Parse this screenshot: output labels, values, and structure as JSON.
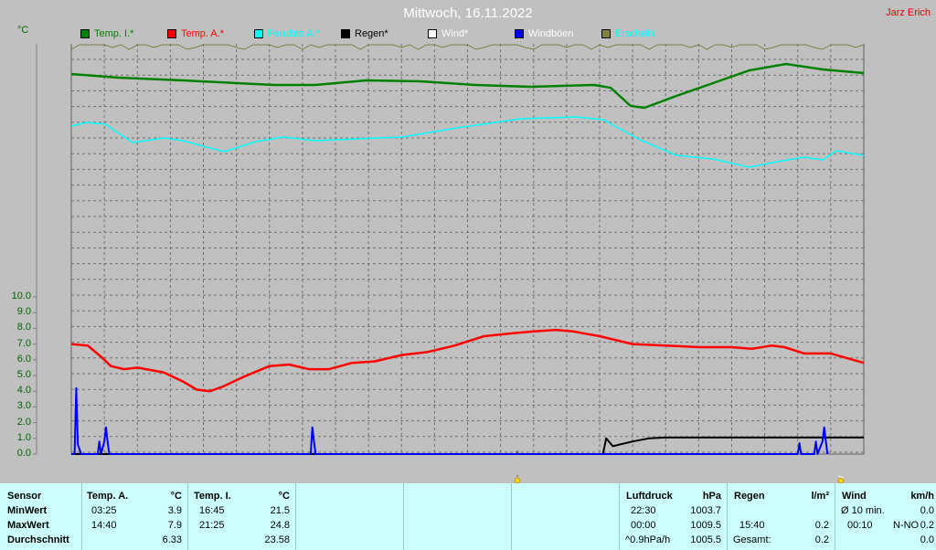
{
  "title": "Mittwoch, 16.11.2022",
  "author": "Jarz Erich",
  "unit_label": "°C",
  "legend": [
    {
      "label": "Temp. I.*",
      "color": "#008000"
    },
    {
      "label": "Temp. A.*",
      "color": "#ff0000"
    },
    {
      "label": "Feuchte A.*",
      "color": "#00ffff"
    },
    {
      "label": "Regen*",
      "color": "#000000"
    },
    {
      "label": "Wind*",
      "color": "#ffffff"
    },
    {
      "label": "Windböen",
      "color": "#0000ff"
    },
    {
      "label": "Erschein.",
      "color": "#808040"
    }
  ],
  "chart_data": {
    "type": "line",
    "title": "Mittwoch, 16.11.2022",
    "ylabel": "°C",
    "ylim": [
      0,
      10
    ],
    "yticks": [
      "0.0",
      "1.0",
      "2.0",
      "3.0",
      "4.0",
      "5.0",
      "6.0",
      "7.0",
      "8.0",
      "9.0",
      "10.0"
    ],
    "x_hours": [
      0,
      24
    ],
    "grid": true,
    "series": [
      {
        "name": "Temp. A.*",
        "color": "#ff0000",
        "x": [
          0,
          0.5,
          0.9,
          1.2,
          1.6,
          2.0,
          2.8,
          3.4,
          3.8,
          4.2,
          4.6,
          5.2,
          6.0,
          6.6,
          7.2,
          7.8,
          8.5,
          9.2,
          10.0,
          10.8,
          11.6,
          12.5,
          13.4,
          14.0,
          14.67,
          15.2,
          16.0,
          17.0,
          18.0,
          19.0,
          20.0,
          20.6,
          21.2,
          21.6,
          22.2,
          23.0,
          24.0
        ],
        "y": [
          7.0,
          6.9,
          6.2,
          5.6,
          5.4,
          5.5,
          5.2,
          4.6,
          4.1,
          4.0,
          4.3,
          4.9,
          5.6,
          5.7,
          5.4,
          5.4,
          5.8,
          5.9,
          6.3,
          6.5,
          6.9,
          7.5,
          7.7,
          7.8,
          7.9,
          7.8,
          7.5,
          7.0,
          6.9,
          6.8,
          6.8,
          6.7,
          6.9,
          6.8,
          6.4,
          6.4,
          5.8
        ]
      },
      {
        "name": "Regen*",
        "color": "#000000",
        "x": [
          0,
          15.5,
          16.1,
          16.2,
          16.4,
          17.0,
          17.5,
          18.0,
          20.0,
          22.0,
          24.0
        ],
        "y": [
          0,
          0,
          0,
          1.0,
          0.5,
          0.8,
          1.0,
          1.05,
          1.05,
          1.05,
          1.05
        ]
      },
      {
        "name": "Windböen",
        "color": "#0000ff",
        "x": [
          0,
          0.1,
          0.15,
          0.2,
          0.3,
          0.35,
          0.8,
          0.85,
          0.9,
          1.0,
          1.05,
          1.1,
          1.15,
          7.25,
          7.3,
          7.35,
          7.4,
          22.0,
          22.05,
          22.1,
          22.5,
          22.55,
          22.6,
          22.75,
          22.8,
          22.85,
          22.9
        ],
        "y": [
          0,
          0,
          4.2,
          0.6,
          0,
          0,
          0,
          0.8,
          0,
          0.8,
          1.7,
          0.8,
          0,
          0,
          1.7,
          0.8,
          0,
          0,
          0.7,
          0,
          0,
          0.8,
          0,
          0.8,
          1.7,
          0.8,
          0
        ]
      }
    ]
  },
  "stats": {
    "sensor": {
      "header": "Sensor",
      "rows": [
        "MinWert",
        "MaxWert",
        "Durchschnitt"
      ]
    },
    "temp_a": {
      "header": "Temp. A.",
      "unit": "°C",
      "min_time": "03:25",
      "min_val": "3.9",
      "max_time": "14:40",
      "max_val": "7.9",
      "avg_val": "6.33"
    },
    "temp_i": {
      "header": "Temp. I.",
      "unit": "°C",
      "min_time": "16:45",
      "min_val": "21.5",
      "max_time": "21:25",
      "max_val": "24.8",
      "avg_val": "23.58"
    },
    "pressure": {
      "header": "Luftdruck",
      "unit": "hPa",
      "min_time": "22:30",
      "min_val": "1003.7",
      "max_time": "00:00",
      "max_val": "1009.5",
      "trend_label": "^0.9hPa/h",
      "trend_val": "1005.5"
    },
    "rain": {
      "header": "Regen",
      "unit": "l/m²",
      "max_time": "15:40",
      "max_val": "0.2",
      "total_label": "Gesamt:",
      "total_val": "0.2"
    },
    "wind": {
      "header": "Wind",
      "unit": "km/h",
      "avg_label": "Ø 10 min.",
      "avg_val": "0.0",
      "gust_time": "00:10",
      "gust_dir": "N-NO",
      "gust_val": "0.2",
      "last_val": "0.0"
    }
  }
}
